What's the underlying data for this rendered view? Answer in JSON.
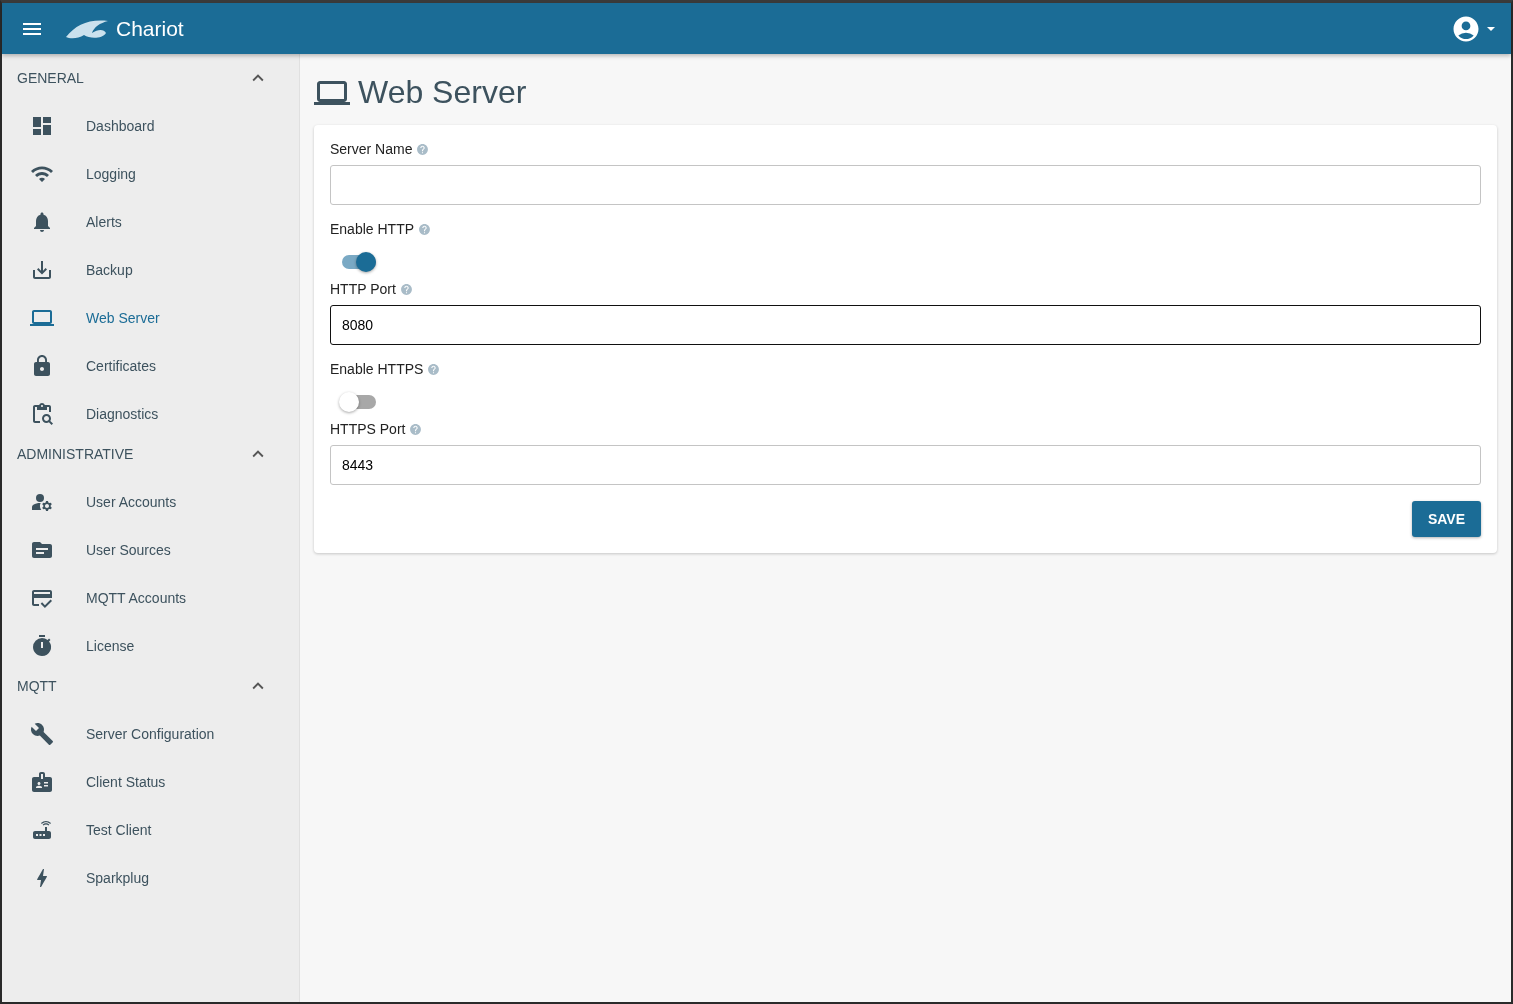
{
  "app_bar": {
    "title": "Chariot"
  },
  "sidebar": {
    "sections": [
      {
        "title": "GENERAL",
        "expanded": true,
        "items": [
          {
            "label": "Dashboard",
            "selected": false
          },
          {
            "label": "Logging",
            "selected": false
          },
          {
            "label": "Alerts",
            "selected": false
          },
          {
            "label": "Backup",
            "selected": false
          },
          {
            "label": "Web Server",
            "selected": true
          },
          {
            "label": "Certificates",
            "selected": false
          },
          {
            "label": "Diagnostics",
            "selected": false
          }
        ]
      },
      {
        "title": "ADMINISTRATIVE",
        "expanded": true,
        "items": [
          {
            "label": "User Accounts",
            "selected": false
          },
          {
            "label": "User Sources",
            "selected": false
          },
          {
            "label": "MQTT Accounts",
            "selected": false
          },
          {
            "label": "License",
            "selected": false
          }
        ]
      },
      {
        "title": "MQTT",
        "expanded": true,
        "items": [
          {
            "label": "Server Configuration",
            "selected": false
          },
          {
            "label": "Client Status",
            "selected": false
          },
          {
            "label": "Test Client",
            "selected": false
          },
          {
            "label": "Sparkplug",
            "selected": false
          }
        ]
      }
    ]
  },
  "page": {
    "title": "Web Server"
  },
  "form": {
    "fields": [
      {
        "kind": "text",
        "label": "Server Name",
        "focused": false
      },
      {
        "kind": "switch",
        "label": "Enable HTTP",
        "on": true
      },
      {
        "kind": "text",
        "label": "HTTP Port",
        "value": "8080",
        "focused": true
      },
      {
        "kind": "switch",
        "label": "Enable HTTPS",
        "on": false
      },
      {
        "kind": "text",
        "label": "HTTPS Port",
        "value": "8443",
        "focused": false
      }
    ],
    "save_button": "SAVE"
  }
}
